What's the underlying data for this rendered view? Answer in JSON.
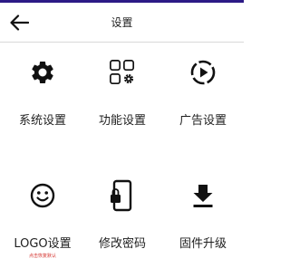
{
  "theme": {
    "accent": "#2c1a86",
    "icon_color": "#111111",
    "sublabel_color": "#d4302b"
  },
  "header": {
    "title": "设置",
    "back_icon": "arrow-left-icon"
  },
  "menu": {
    "items": [
      {
        "label": "系统设置",
        "icon": "gear-icon"
      },
      {
        "label": "功能设置",
        "icon": "grid-gear-icon"
      },
      {
        "label": "广告设置",
        "icon": "play-circle-icon"
      },
      {
        "label": "LOGO设置",
        "icon": "smiley-icon",
        "sublabel": "点击恢复默认"
      },
      {
        "label": "修改密码",
        "icon": "phone-lock-icon"
      },
      {
        "label": "固件升级",
        "icon": "download-icon"
      }
    ]
  }
}
